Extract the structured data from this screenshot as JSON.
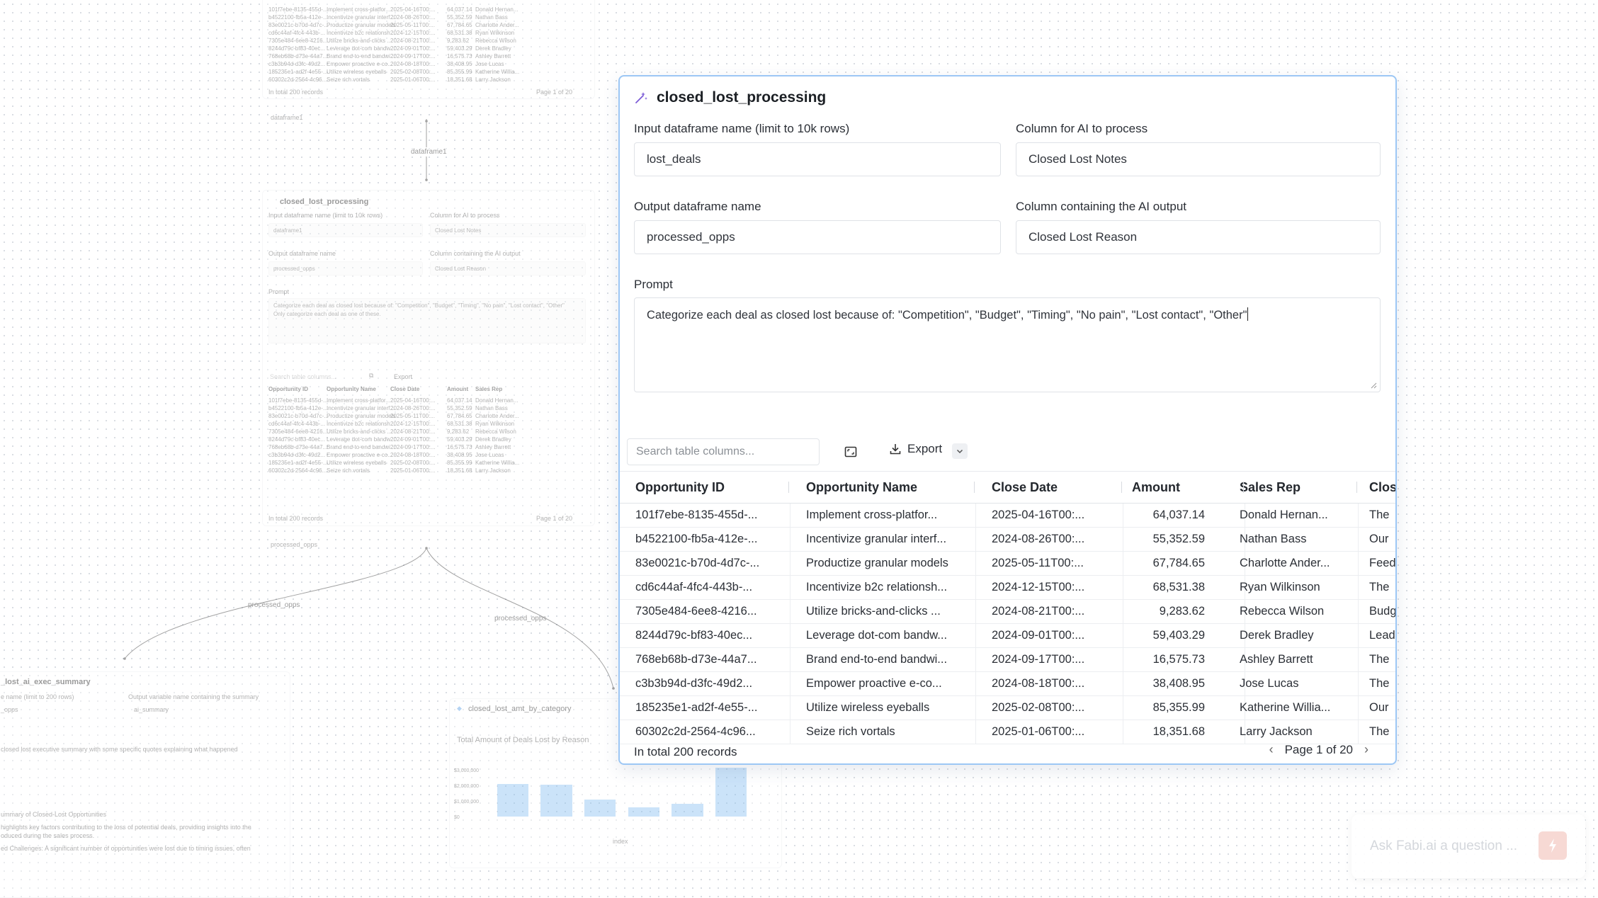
{
  "card": {
    "title": "closed_lost_processing",
    "input_label": "Input dataframe name (limit to 10k rows)",
    "input_value": "lost_deals",
    "column_label": "Column for AI to process",
    "column_value": "Closed Lost Notes",
    "output_label": "Output dataframe name",
    "output_value": "processed_opps",
    "ai_output_label": "Column containing the AI output",
    "ai_output_value": "Closed Lost Reason",
    "prompt_label": "Prompt",
    "prompt_value": "Categorize each deal as closed lost because of: \"Competition\", \"Budget\", \"Timing\", \"No pain\", \"Lost contact\", \"Other\"",
    "search_placeholder": "Search table columns...",
    "export_label": "Export",
    "table": {
      "headers": [
        "Opportunity ID",
        "Opportunity Name",
        "Close Date",
        "Amount",
        "Sales Rep",
        "Clos"
      ],
      "rows": [
        [
          "101f7ebe-8135-455d-...",
          "Implement cross-platfor...",
          "2025-04-16T00:...",
          "64,037.14",
          "Donald Hernan...",
          "The"
        ],
        [
          "b4522100-fb5a-412e-...",
          "Incentivize granular interf...",
          "2024-08-26T00:...",
          "55,352.59",
          "Nathan Bass",
          "Our"
        ],
        [
          "83e0021c-b70d-4d7c-...",
          "Productize granular models",
          "2025-05-11T00:...",
          "67,784.65",
          "Charlotte Ander...",
          "Feed"
        ],
        [
          "cd6c44af-4fc4-443b-...",
          "Incentivize b2c relationsh...",
          "2024-12-15T00:...",
          "68,531.38",
          "Ryan Wilkinson",
          "The"
        ],
        [
          "7305e484-6ee8-4216...",
          "Utilize bricks-and-clicks ...",
          "2024-08-21T00:...",
          "9,283.62",
          "Rebecca Wilson",
          "Budg"
        ],
        [
          "8244d79c-bf83-40ec...",
          "Leverage dot-com bandw...",
          "2024-09-01T00:...",
          "59,403.29",
          "Derek Bradley",
          "Lead"
        ],
        [
          "768eb68b-d73e-44a7...",
          "Brand end-to-end bandwi...",
          "2024-09-17T00:...",
          "16,575.73",
          "Ashley Barrett",
          "The"
        ],
        [
          "c3b3b94d-d3fc-49d2...",
          "Empower proactive e-co...",
          "2024-08-18T00:...",
          "38,408.95",
          "Jose Lucas",
          "The"
        ],
        [
          "185235e1-ad2f-4e55-...",
          "Utilize wireless eyeballs",
          "2025-02-08T00:...",
          "85,355.99",
          "Katherine Willia...",
          "Our"
        ],
        [
          "60302c2d-2564-4c96...",
          "Seize rich vortals",
          "2025-01-06T00:...",
          "18,351.68",
          "Larry Jackson",
          "The"
        ]
      ]
    },
    "total_records": "In total 200 records",
    "page_label": "Page 1 of 20"
  },
  "background": {
    "top_total": "In total 200 records",
    "top_page": "Page 1 of 20",
    "df1_label": "dataframe1",
    "df1_conn_label": "dataframe1",
    "mini_title": "closed_lost_processing",
    "mini_input_label": "Input dataframe name (limit to 10k rows)",
    "mini_input_value": "dataframe1",
    "mini_column_label": "Column for AI to process",
    "mini_column_value": "Closed Lost Notes",
    "mini_output_label": "Output dataframe name",
    "mini_output_value": "processed_opps",
    "mini_ai_label": "Column containing the AI output",
    "mini_ai_value": "Closed Lost Reason",
    "mini_prompt_label": "Prompt",
    "mini_prompt_line1": "Categorize each deal as closed lost because of: \"Competition\", \"Budget\", \"Timing\", \"No pain\", \"Lost contact\", \"Other\"",
    "mini_prompt_line2": "Only categorize each deal as one of these.",
    "mini_search": "Search table columns...",
    "mini_export": "Export",
    "mini_headers": [
      "Opportunity ID",
      "Opportunity Name",
      "Close Date",
      "Amount",
      "Sales Rep"
    ],
    "mini_total": "In total 200 records",
    "mini_page": "Page 1 of 20",
    "processed_label": "processed_opps",
    "conn_label_a": "processed_opps",
    "conn_label_b": "processed_opps",
    "summary_title": "_lost_ai_exec_summary",
    "summary_input_label": "e name (limit to 200 rows)",
    "summary_input_value": "_opps",
    "summary_output_label": "Output variable name containing the summary",
    "summary_output_value": "ai_summary",
    "summary_prompt": "closed lost executive summary with some specific quotes explaining what happened",
    "summary_heading": "ummary of Closed-Lost Opportunities",
    "summary_text1": "highlights key factors contributing to the loss of potential deals, providing insights into the",
    "summary_text2": "oduced during the sales process.",
    "summary_text3": "ed Challenges: A significant number of opportunities were lost due to timing issues, often",
    "chart_title": "closed_lost_amt_by_category",
    "chart_subtitle": "Total Amount of Deals Lost by Reason",
    "chart_yticks": [
      "$3,000,000",
      "$2,000,000",
      "$1,000,000",
      "$0"
    ],
    "chart_xlabel": "index"
  },
  "chart_data": {
    "type": "bar",
    "title": "Total Amount of Deals Lost by Reason",
    "xlabel": "index",
    "ylabel": "",
    "ylim": [
      0,
      3000000
    ],
    "values": [
      2050000,
      1980000,
      1080000,
      560000,
      780000,
      3050000
    ]
  },
  "ask": {
    "placeholder": "Ask Fabi.ai a question ..."
  },
  "colors": {
    "accent_border": "#9cc7f5",
    "bar": "#8ec3f2",
    "ask_button": "#f7d9d4"
  }
}
